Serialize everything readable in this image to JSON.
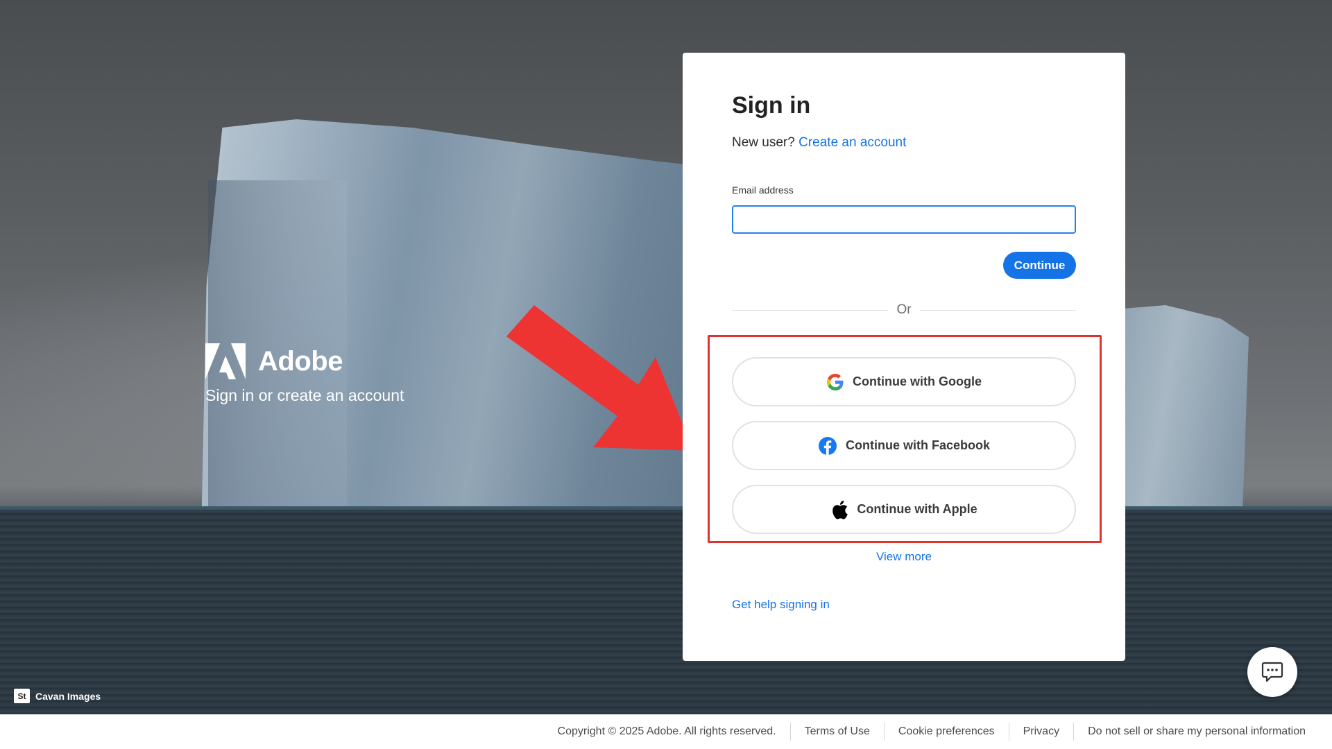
{
  "brand": {
    "name": "Adobe",
    "tagline": "Sign in or create an account"
  },
  "photo_credit": {
    "badge": "St",
    "text": "Cavan Images"
  },
  "signin": {
    "title": "Sign in",
    "new_user_prefix": "New user?",
    "create_account_link": "Create an account",
    "email_label": "Email address",
    "email_value": "",
    "continue_label": "Continue",
    "or_text": "Or",
    "social": [
      {
        "label": "Continue with Google",
        "icon": "google-icon"
      },
      {
        "label": "Continue with Facebook",
        "icon": "facebook-icon"
      },
      {
        "label": "Continue with Apple",
        "icon": "apple-icon"
      }
    ],
    "view_more": "View more",
    "help_link": "Get help signing in"
  },
  "footer": {
    "copyright": "Copyright © 2025 Adobe. All rights reserved.",
    "links": [
      "Terms of Use",
      "Cookie preferences",
      "Privacy",
      "Do not sell or share my personal information"
    ]
  },
  "colors": {
    "accent": "#1473e6",
    "highlight_box": "#e0322f",
    "arrow": "#ee3333"
  }
}
